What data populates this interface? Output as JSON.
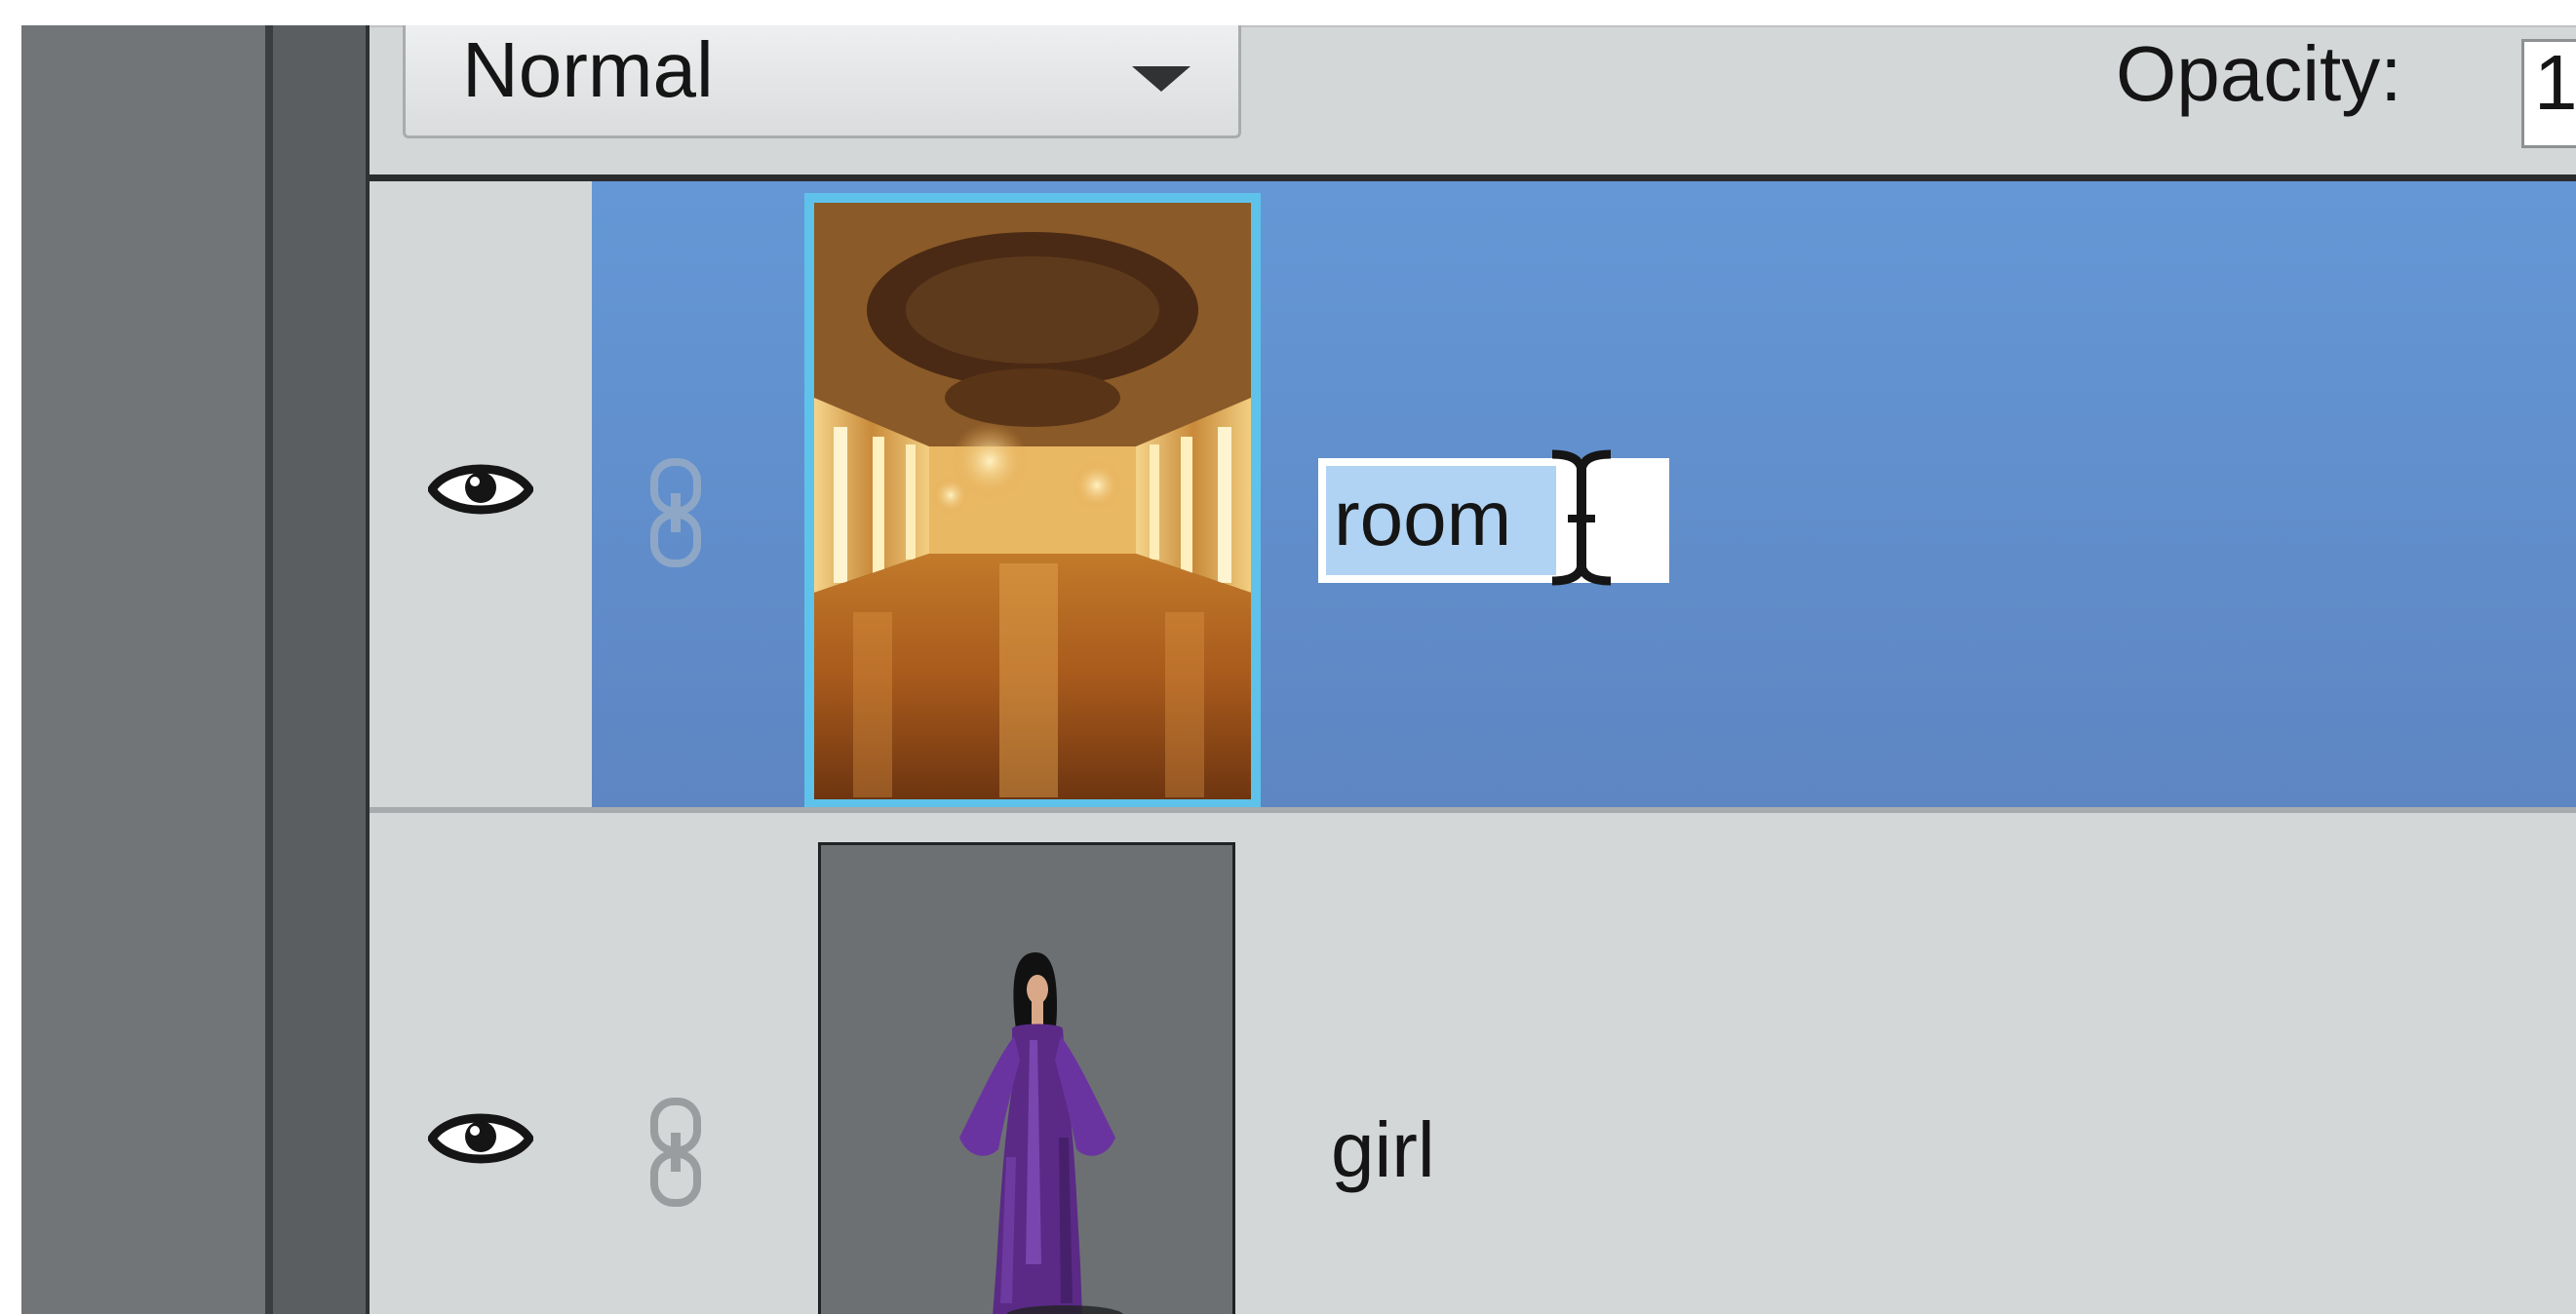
{
  "toolbar": {
    "blend_mode": "Normal",
    "opacity_label": "Opacity:",
    "opacity_value": "1"
  },
  "layers": [
    {
      "name": "room",
      "selected": true,
      "editing_name": true,
      "visible": true,
      "thumbnail": "ballroom-interior"
    },
    {
      "name": "girl",
      "selected": false,
      "editing_name": false,
      "visible": true,
      "thumbnail": "woman-in-purple-gown"
    }
  ],
  "icons": {
    "visibility": "eye-icon",
    "link": "link-icon",
    "dropdown": "chevron-down-icon",
    "cursor": "text-cursor-icon"
  },
  "colors": {
    "selected_row": "#6597d6",
    "panel_bg": "#d4d7d8",
    "thumbnail_highlight": "#5ec2ea",
    "text_selection": "#b0d2f3"
  }
}
